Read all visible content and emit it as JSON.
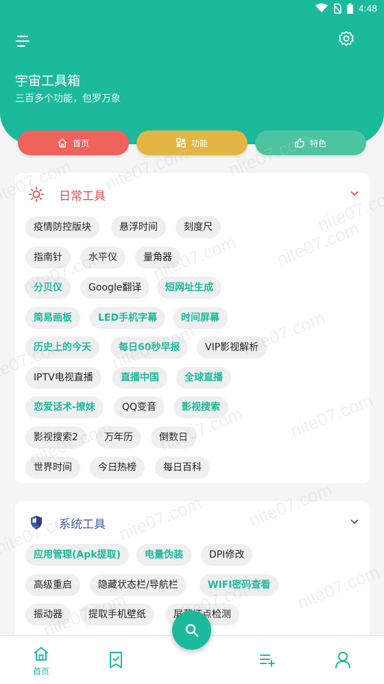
{
  "status": {
    "time": "4:48"
  },
  "app": {
    "title": "宇宙工具箱",
    "subtitle": "三百多个功能，包罗万象"
  },
  "tabs": [
    {
      "label": "首页",
      "icon": "home-icon",
      "color": "#f0625c"
    },
    {
      "label": "功能",
      "icon": "grid-icon",
      "color": "#e3b543"
    },
    {
      "label": "特色",
      "icon": "thumbs-up-icon",
      "color": "#4cc49f"
    }
  ],
  "sections": {
    "daily": {
      "title": "日常工具",
      "icon": "sun-icon",
      "items": [
        {
          "label": "疫情防控版块",
          "highlight": false
        },
        {
          "label": "悬浮时间",
          "highlight": false
        },
        {
          "label": "刻度尺",
          "highlight": false
        },
        {
          "label": "指南针",
          "highlight": false
        },
        {
          "label": "水平仪",
          "highlight": false
        },
        {
          "label": "量角器",
          "highlight": false
        },
        {
          "label": "分贝仪",
          "highlight": true
        },
        {
          "label": "Google翻译",
          "highlight": false
        },
        {
          "label": "短网址生成",
          "highlight": true
        },
        {
          "label": "简易画板",
          "highlight": true
        },
        {
          "label": "LED手机字幕",
          "highlight": true
        },
        {
          "label": "时间屏幕",
          "highlight": true
        },
        {
          "label": "历史上的今天",
          "highlight": true
        },
        {
          "label": "每日60秒早报",
          "highlight": true
        },
        {
          "label": "VIP影视解析",
          "highlight": false
        },
        {
          "label": "IPTV电视直播",
          "highlight": false
        },
        {
          "label": "直播中国",
          "highlight": true
        },
        {
          "label": "全球直播",
          "highlight": true
        },
        {
          "label": "恋爱话术-撩妹",
          "highlight": true
        },
        {
          "label": "QQ变音",
          "highlight": false
        },
        {
          "label": "影视搜索",
          "highlight": true
        },
        {
          "label": "影视搜索2",
          "highlight": false
        },
        {
          "label": "万年历",
          "highlight": false
        },
        {
          "label": "倒数日",
          "highlight": false
        },
        {
          "label": "世界时间",
          "highlight": false
        },
        {
          "label": "今日热榜",
          "highlight": false
        },
        {
          "label": "每日百科",
          "highlight": false
        }
      ]
    },
    "system": {
      "title": "系统工具",
      "icon": "shield-icon",
      "items": [
        {
          "label": "应用管理(Apk提取)",
          "highlight": true
        },
        {
          "label": "电量伪装",
          "highlight": true
        },
        {
          "label": "DPI修改",
          "highlight": false
        },
        {
          "label": "高级重启",
          "highlight": false
        },
        {
          "label": "隐藏状态栏/导航栏",
          "highlight": false
        },
        {
          "label": "WIFI密码查看",
          "highlight": true
        },
        {
          "label": "振动器",
          "highlight": false
        },
        {
          "label": "提取手机壁纸",
          "highlight": false
        },
        {
          "label": "屏幕坏点检测",
          "highlight": false
        }
      ]
    }
  },
  "bottom_nav": [
    {
      "label": "首页",
      "icon": "home-icon",
      "active": true
    },
    {
      "label": "",
      "icon": "bookmark-check-icon",
      "active": false
    },
    {
      "label": "",
      "icon": "playlist-add-icon",
      "active": false
    },
    {
      "label": "",
      "icon": "user-icon",
      "active": false
    }
  ],
  "fab": {
    "icon": "search-icon"
  },
  "watermark": "nite07.com",
  "colors": {
    "accent": "#1cba9c",
    "red": "#e44b48",
    "blue": "#3e56a6"
  }
}
